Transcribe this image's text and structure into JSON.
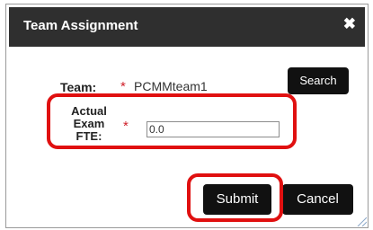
{
  "dialog": {
    "title": "Team Assignment",
    "close_icon": "close-icon",
    "team_label": "Team:",
    "required_marker": "*",
    "team_value": "PCMMteam1",
    "search_label": "Search",
    "fte_label_line1": "Actual",
    "fte_label_line2": "Exam",
    "fte_label_line3": "FTE:",
    "fte_value": "0.0",
    "submit_label": "Submit",
    "cancel_label": "Cancel"
  },
  "colors": {
    "titlebar": "#2f2f2f",
    "button": "#111111",
    "required": "#d0202a",
    "highlight": "#e01010"
  }
}
